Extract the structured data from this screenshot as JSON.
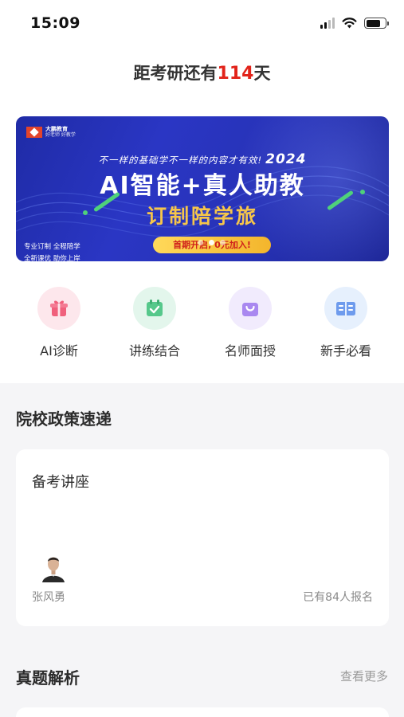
{
  "status_bar": {
    "time": "15:09",
    "signal_icon": "cellular-signal-icon",
    "wifi_icon": "wifi-icon",
    "battery_icon": "battery-icon"
  },
  "countdown": {
    "prefix": "距考研还有",
    "days": "114",
    "suffix": "天"
  },
  "banner": {
    "brand_name": "大鹏教育",
    "brand_tagline": "好老师 好教学",
    "slogan": "不一样的基础学不一样的内容才有效!",
    "year": "2024",
    "title": "AI智能+真人助教",
    "subtitle": "订制陪学旅",
    "cta": "首期开启, 0元加入!",
    "tags": [
      "专业订制  全程陪学",
      "全新课优 助你上岸"
    ],
    "colors": {
      "background": "#2732b6",
      "accent": "#f6c64a",
      "cta_text": "#d0211b",
      "deco": "#4fd17a"
    },
    "carousel": {
      "count": 3,
      "active": 1
    }
  },
  "quick_actions": [
    {
      "label": "AI诊断",
      "icon": "gift-icon",
      "bg": "#fde7ec",
      "color": "#f0607c"
    },
    {
      "label": "讲练结合",
      "icon": "calendar-check-icon",
      "bg": "#e3f6ec",
      "color": "#56c88b"
    },
    {
      "label": "名师面授",
      "icon": "shopping-bag-icon",
      "bg": "#f1ebfd",
      "color": "#a988f0"
    },
    {
      "label": "新手必看",
      "icon": "book-icon",
      "bg": "#e6f0fd",
      "color": "#6e9bed"
    }
  ],
  "policy_section": {
    "title": "院校政策速递"
  },
  "lecture_card": {
    "title": "备考讲座",
    "lecturer": "张风勇",
    "enrolled": "已有84人报名",
    "avatar_icon": "lecturer-avatar-icon"
  },
  "exam_section": {
    "title": "真题解析",
    "more": "查看更多"
  },
  "colors": {
    "countdown_highlight": "#e2231a",
    "section_bg": "#f5f5f7"
  }
}
